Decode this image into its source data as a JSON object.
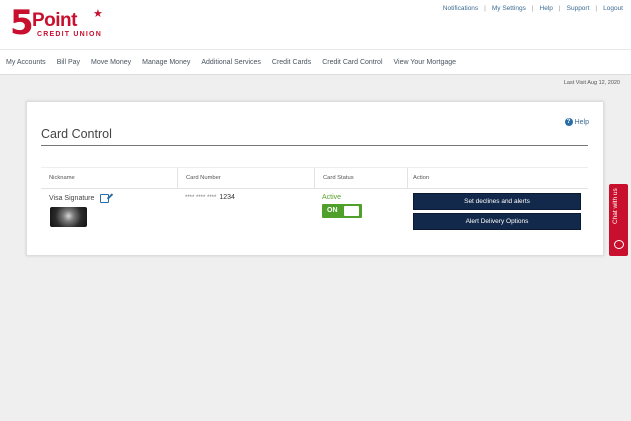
{
  "logo": {
    "number": "5",
    "name": "Point",
    "subtitle": "CREDIT UNION",
    "star": "★"
  },
  "utility_nav": [
    "Notifications",
    "My Settings",
    "Help",
    "Support",
    "Logout"
  ],
  "main_nav": [
    "My Accounts",
    "Bill Pay",
    "Move Money",
    "Manage Money",
    "Additional Services",
    "Credit Cards",
    "Credit Card Control",
    "View Your Mortgage"
  ],
  "last_visit": "Last Visit Aug 12, 2020",
  "panel": {
    "help_label": "Help",
    "title": "Card Control",
    "columns": [
      "Nickname",
      "Card Number",
      "Card Status",
      "Action"
    ],
    "row": {
      "nickname": "Visa Signature",
      "card_number_mask": "**** **** ****",
      "card_number_last": "1234",
      "status": "Active",
      "toggle_label": "ON",
      "toggle_state": "on",
      "actions": [
        "Set declines and alerts",
        "Alert Delivery Options"
      ]
    }
  },
  "chat": {
    "label": "Chat with us"
  },
  "colors": {
    "brand_red": "#c8102e",
    "navy_button": "#13294b",
    "toggle_green": "#4ea02a",
    "link_blue": "#3d6b93"
  }
}
